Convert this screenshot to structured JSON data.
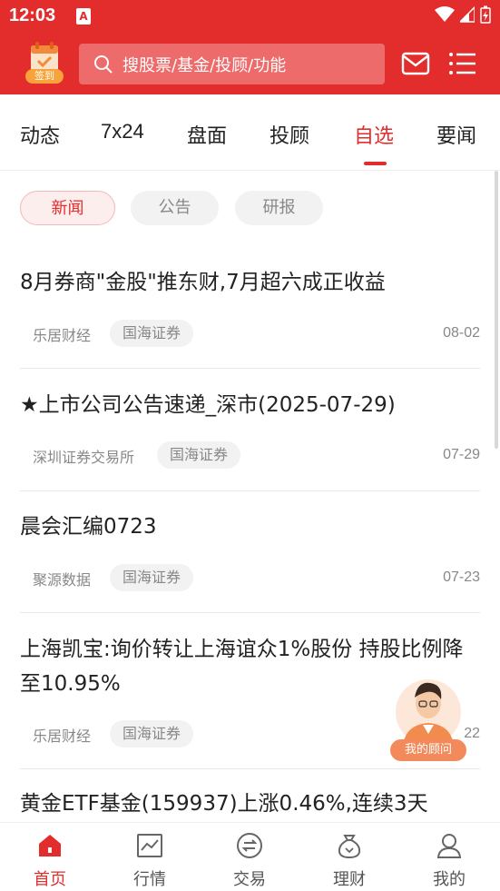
{
  "status": {
    "time": "12:03",
    "app_icon": "A"
  },
  "header": {
    "checkin_label": "签到",
    "search_placeholder": "搜股票/基金/投顾/功能"
  },
  "tabs": [
    {
      "label": "动态"
    },
    {
      "label": "7x24"
    },
    {
      "label": "盘面"
    },
    {
      "label": "投顾"
    },
    {
      "label": "自选",
      "active": true
    },
    {
      "label": "要闻"
    }
  ],
  "filters": [
    {
      "label": "新闻",
      "active": true
    },
    {
      "label": "公告"
    },
    {
      "label": "研报"
    }
  ],
  "news": [
    {
      "title": "8月券商\"金股\"推东财,7月超六成正收益",
      "source": "乐居财经",
      "tag": "国海证券",
      "date": "08-02"
    },
    {
      "title": "★上市公司公告速递_深市(2025-07-29)",
      "source": "深圳证券交易所",
      "tag": "国海证券",
      "date": "07-29"
    },
    {
      "title": "晨会汇编0723",
      "source": "聚源数据",
      "tag": "国海证券",
      "date": "07-23"
    },
    {
      "title": "上海凯宝:询价转让上海谊众1%股份 持股比例降至10.95%",
      "source": "乐居财经",
      "tag": "国海证券",
      "date": "22"
    },
    {
      "title": "黄金ETF基金(159937)上涨0.46%,连续3天"
    }
  ],
  "advisor": {
    "label": "我的顾问"
  },
  "bottom_nav": [
    {
      "label": "首页",
      "active": true
    },
    {
      "label": "行情"
    },
    {
      "label": "交易"
    },
    {
      "label": "理财"
    },
    {
      "label": "我的"
    }
  ],
  "colors": {
    "brand_red": "#e32d2d",
    "muted": "#888888"
  }
}
